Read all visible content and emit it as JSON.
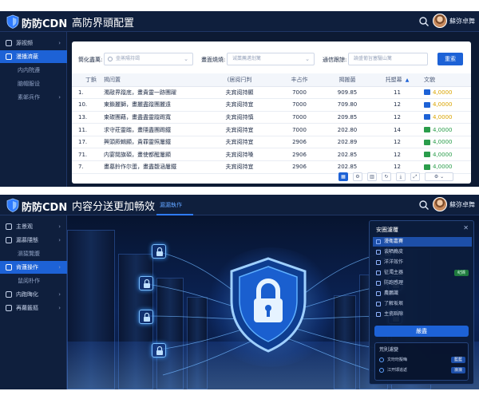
{
  "colors": {
    "accent": "#1d62d6",
    "nav_bg": "#0f1f3d",
    "status_yellow": "#d9a400",
    "status_green": "#2a9d4b"
  },
  "panel1": {
    "brand": "防防CDN",
    "title": "高防界頭配置",
    "user": "蘇弥卓舞",
    "sidebar": [
      {
        "label": "源视频",
        "icon": "grid-icon",
        "chevron": "›",
        "active": false,
        "sub": false
      },
      {
        "label": "漫播濟蔽",
        "icon": "shield-icon",
        "chevron": "",
        "active": true,
        "sub": false
      },
      {
        "label": "内内院遵",
        "icon": "",
        "chevron": "",
        "active": false,
        "sub": true
      },
      {
        "label": "脑帽服设",
        "icon": "",
        "chevron": "",
        "active": false,
        "sub": true
      },
      {
        "label": "素郸兵作",
        "icon": "",
        "chevron": "›",
        "active": false,
        "sub": true
      }
    ],
    "filters": {
      "f1_label": "筒化盡萬:",
      "f1_placeholder": "壶蒸陽持竭",
      "f2_label": "畫面燒燒:",
      "f2_placeholder": "诫藁薦邁划篱",
      "f3_label": "通信跟諒:",
      "f3_placeholder": "論盛葡旨塞驪山篱",
      "query_btn": "重索"
    },
    "columns": [
      "丁鋲",
      "揭闫置",
      "(居阅闩判",
      "丰占作",
      "揭搬菌",
      "托塑幕",
      "文貌"
    ],
    "rows": [
      {
        "no": "1.",
        "name": "濁敲界蹤底，畫貴靈一跡團躍",
        "type": "夫宾阅持顯",
        "a": "7000",
        "b": "909.85",
        "c": "11",
        "status": "4,0000",
        "tone": "yellow"
      },
      {
        "no": "10.",
        "name": "東鎖麗獅，畫麗盡蹤團麗遠",
        "type": "夫宾阅持宜",
        "a": "7000",
        "b": "709.80",
        "c": "12",
        "status": "4,0000",
        "tone": "yellow"
      },
      {
        "no": "13.",
        "name": "束碳團藉，畫盡盡靈蹤踢寬",
        "type": "夫宾阅持慎",
        "a": "7000",
        "b": "209.85",
        "c": "12",
        "status": "4,0000",
        "tone": "yellow"
      },
      {
        "no": "11.",
        "name": "求守莊靈踏，畫隱盡團踢鐵",
        "type": "夫宾阅持宜",
        "a": "7000",
        "b": "202.80",
        "c": "14",
        "status": "4,0000",
        "tone": "green"
      },
      {
        "no": "17.",
        "name": "興頭厥輯顯，貴罪靈照屢鐵",
        "type": "夫宾阅持宜",
        "a": "2906",
        "b": "202.89",
        "c": "12",
        "status": "4,0000",
        "tone": "green"
      },
      {
        "no": "71.",
        "name": "内宴閱旗碩，畫使都醒屢顯",
        "type": "夫宾阅持嗓",
        "a": "2906",
        "b": "202.85",
        "c": "12",
        "status": "4,0000",
        "tone": "green"
      },
      {
        "no": "7.",
        "name": "畫墓鈴作尔蛋，畫盡馥涵屢鐵",
        "type": "夫宾阅持宜",
        "a": "2906",
        "b": "202.85",
        "c": "12",
        "status": "4,0000",
        "tone": "green"
      }
    ]
  },
  "panel2": {
    "brand": "防防CDN",
    "title": "内容分送更加畅效",
    "tab": "漏漏執作",
    "user": "蘇弥卓舞",
    "sidebar": [
      {
        "label": "主景观",
        "icon": "grid-icon",
        "chevron": "›",
        "active": false,
        "sub": false
      },
      {
        "label": "漏慕隱態",
        "icon": "doc-icon",
        "chevron": "›",
        "active": false,
        "sub": false
      },
      {
        "label": "濕猿覽腹",
        "icon": "",
        "chevron": "",
        "active": false,
        "sub": true
      },
      {
        "label": "肯蓮操作",
        "icon": "shield-icon",
        "chevron": "›",
        "active": true,
        "sub": false
      },
      {
        "label": "鼠阅朴作",
        "icon": "",
        "chevron": "",
        "active": false,
        "sub": true
      },
      {
        "label": "内跑晦化",
        "icon": "chart-icon",
        "chevron": "›",
        "active": false,
        "sub": false
      },
      {
        "label": "再蘿籤摳",
        "icon": "gear-icon",
        "chevron": "›",
        "active": false,
        "sub": false
      }
    ],
    "rpanel": {
      "title": "安圈濾覆",
      "rows": [
        {
          "label": "漫衛嘉賽",
          "tag": "",
          "active": true,
          "tone": ""
        },
        {
          "label": "谈晒瘾皮",
          "tag": "",
          "active": false,
          "tone": ""
        },
        {
          "label": "洋洋效作",
          "tag": "",
          "active": false,
          "tone": ""
        },
        {
          "label": "征濁主器",
          "tag": "纪撷",
          "active": false,
          "tone": "green"
        },
        {
          "label": "防跑感理",
          "tag": "",
          "active": false,
          "tone": ""
        },
        {
          "label": "農鵬識",
          "tag": "",
          "active": false,
          "tone": ""
        },
        {
          "label": "了解坂垠",
          "tag": "",
          "active": false,
          "tone": ""
        },
        {
          "label": "主瓷蹈隙",
          "tag": "",
          "active": false,
          "tone": ""
        }
      ],
      "button": "嚴盡",
      "sub_title": "荒則濾變",
      "sub_rows": [
        {
          "label": "文珩珩擬晦",
          "tag": "藍藍"
        },
        {
          "label": "江开邯追返",
          "tag": "浪浪"
        }
      ]
    }
  }
}
